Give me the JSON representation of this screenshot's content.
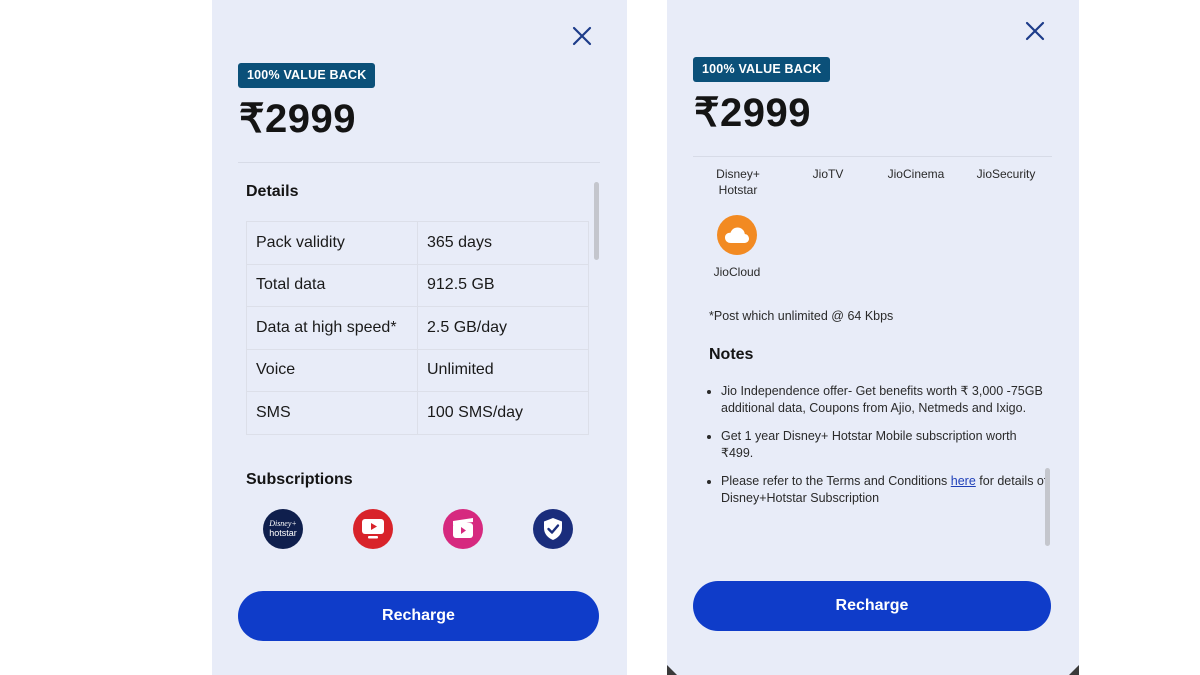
{
  "left": {
    "badge": "100% VALUE BACK",
    "price": "₹2999",
    "details_title": "Details",
    "details": [
      {
        "label": "Pack validity",
        "value": "365 days"
      },
      {
        "label": "Total data",
        "value": "912.5 GB"
      },
      {
        "label": "Data at high speed*",
        "value": "2.5 GB/day"
      },
      {
        "label": "Voice",
        "value": "Unlimited"
      },
      {
        "label": "SMS",
        "value": "100 SMS/day"
      }
    ],
    "subscriptions_title": "Subscriptions",
    "subscriptions": [
      {
        "icon": "disney-hotstar-icon",
        "text": "hotstar",
        "color": "#0f1f4d"
      },
      {
        "icon": "jiotv-icon",
        "color": "#d8232a"
      },
      {
        "icon": "jiocinema-icon",
        "color": "#d6297f"
      },
      {
        "icon": "jiosecurity-icon",
        "color": "#1a2d7c"
      }
    ],
    "recharge_label": "Recharge"
  },
  "right": {
    "badge": "100% VALUE BACK",
    "price": "₹2999",
    "apps": [
      {
        "line1": "Disney+",
        "line2": "Hotstar"
      },
      {
        "line1": "JioTV"
      },
      {
        "line1": "JioCinema"
      },
      {
        "line1": "JioSecurity"
      }
    ],
    "cloud_label": "JioCloud",
    "footnote": "*Post which unlimited @ 64 Kbps",
    "notes_title": "Notes",
    "notes": [
      {
        "text": "Jio Independence offer- Get benefits worth ₹ 3,000 -75GB additional data, Coupons from Ajio, Netmeds and Ixigo."
      },
      {
        "text": "Get 1 year Disney+ Hotstar Mobile subscription worth ₹499."
      },
      {
        "pre": "Please refer to the Terms and Conditions ",
        "link": "here",
        "post": " for details of Disney+Hotstar Subscription"
      }
    ],
    "recharge_label": "Recharge"
  },
  "colors": {
    "panel_bg": "#e8ecf8",
    "badge_bg": "#0b5079",
    "button_bg": "#0f3cc9",
    "close_icon": "#1d3c8a"
  }
}
